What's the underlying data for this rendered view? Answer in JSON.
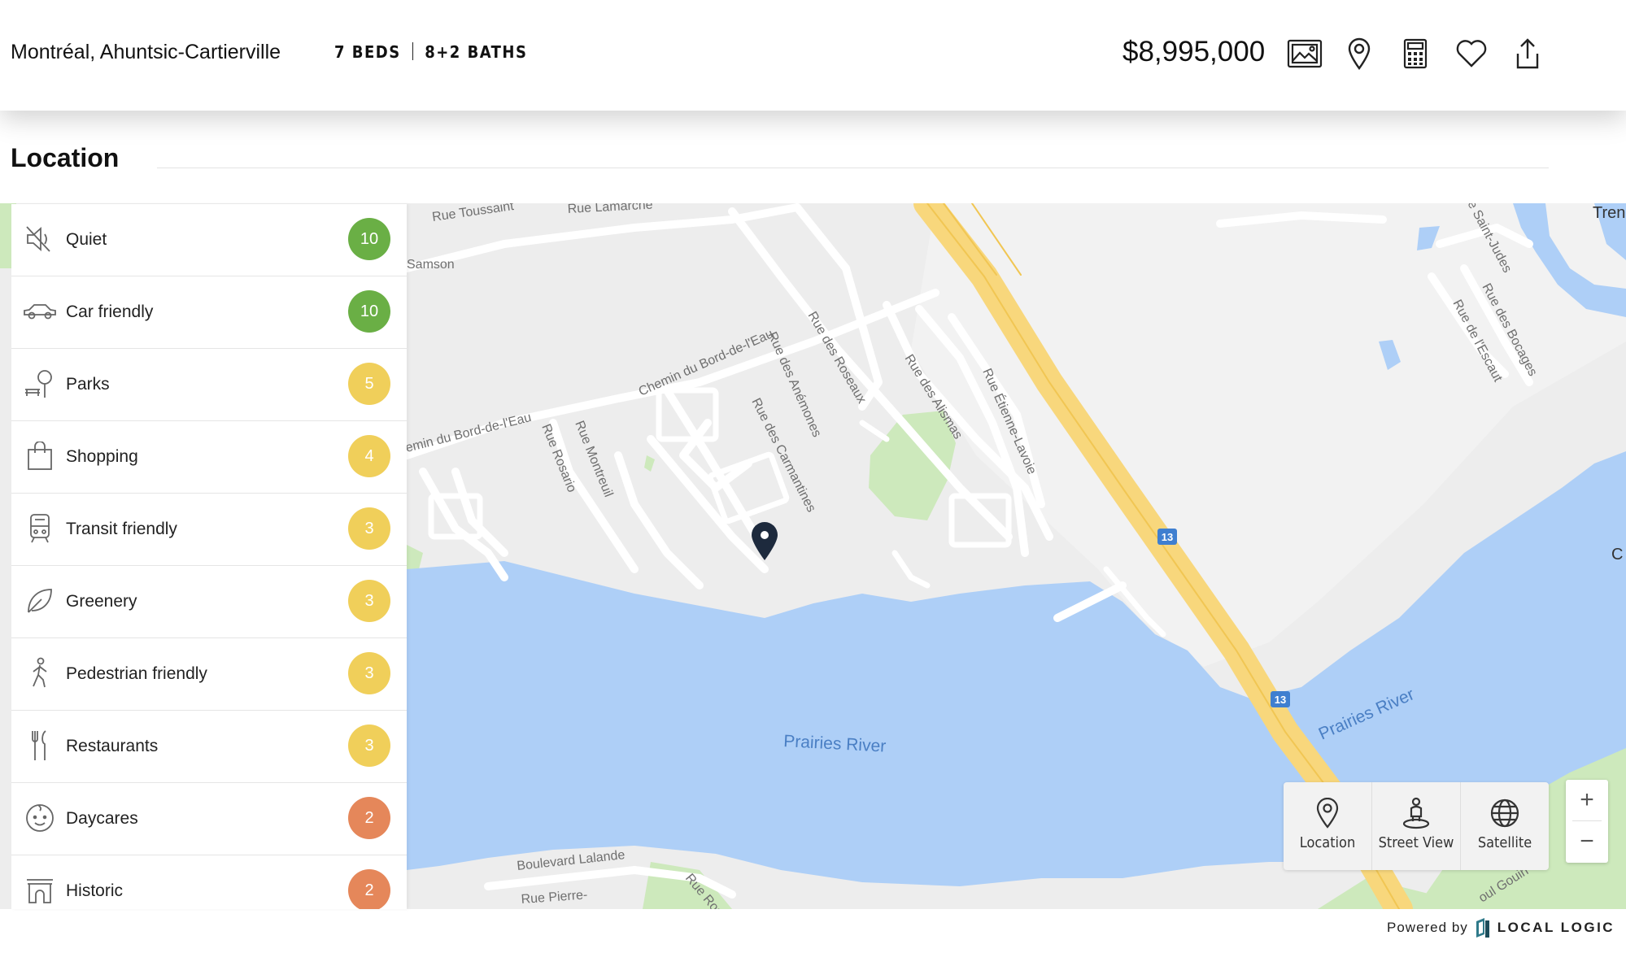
{
  "listing": {
    "address": "Montréal, Ahuntsic-Cartierville",
    "beds": "7 BEDS",
    "baths": "8+2 BATHS",
    "price": "$8,995,000"
  },
  "toolbar": {
    "icons": [
      "photos-icon",
      "map-pin-icon",
      "calculator-icon",
      "heart-icon",
      "share-icon"
    ]
  },
  "section": {
    "title": "Location"
  },
  "scores": [
    {
      "label": "Quiet",
      "score": "10",
      "color": "#6aaf45",
      "icon": "muted-speaker-icon"
    },
    {
      "label": "Car friendly",
      "score": "10",
      "color": "#6aaf45",
      "icon": "car-icon"
    },
    {
      "label": "Parks",
      "score": "5",
      "color": "#f0cf5a",
      "icon": "park-bench-icon"
    },
    {
      "label": "Shopping",
      "score": "4",
      "color": "#f0cf5a",
      "icon": "shopping-bag-icon"
    },
    {
      "label": "Transit friendly",
      "score": "3",
      "color": "#f0cf5a",
      "icon": "train-icon"
    },
    {
      "label": "Greenery",
      "score": "3",
      "color": "#f0cf5a",
      "icon": "leaf-icon"
    },
    {
      "label": "Pedestrian friendly",
      "score": "3",
      "color": "#f0cf5a",
      "icon": "pedestrian-icon"
    },
    {
      "label": "Restaurants",
      "score": "3",
      "color": "#f0cf5a",
      "icon": "fork-knife-icon"
    },
    {
      "label": "Daycares",
      "score": "2",
      "color": "#e5875a",
      "icon": "baby-face-icon"
    },
    {
      "label": "Historic",
      "score": "2",
      "color": "#e5875a",
      "icon": "arch-icon"
    }
  ],
  "map": {
    "labels": {
      "toussaint": "Rue Toussaint",
      "lamarche": "Rue Lamarche",
      "samson": "Samson",
      "bord1": "Chemin du Bord-de-l'Eau",
      "bord2": "emin du Bord-de-l'Eau",
      "rosario": "Rue Rosario",
      "montreuil": "Rue Montreuil",
      "anemones": "Rue des Anémones",
      "carmantines": "Rue des Carmantines",
      "roseaux": "Rue des Roseaux",
      "alismas": "Rue des Alismas",
      "lavoie": "Rue Étienne-Lavoie",
      "saintjudes": "e Saint-Judes",
      "bocages": "Rue des Bocages",
      "escaut": "Rue de l'Escaut",
      "river1": "Prairies River",
      "river2": "Prairies River",
      "lalande": "Boulevard Lalande",
      "pierre": "Rue Pierre-",
      "rose": "Rue Rose",
      "gouin": "oul Gouin O",
      "tren": "Tren",
      "c": "C",
      "hwy1": "13",
      "hwy2": "13"
    },
    "controls": {
      "location": "Location",
      "street_view": "Street View",
      "satellite": "Satellite",
      "zoom_in": "+",
      "zoom_out": "−"
    },
    "colors": {
      "water": "#aecff7",
      "land": "#ededed",
      "park": "#cde9bc",
      "highway": "#f8d77c"
    }
  },
  "footer": {
    "powered_by": "Powered by",
    "brand": "LOCAL LOGIC"
  }
}
